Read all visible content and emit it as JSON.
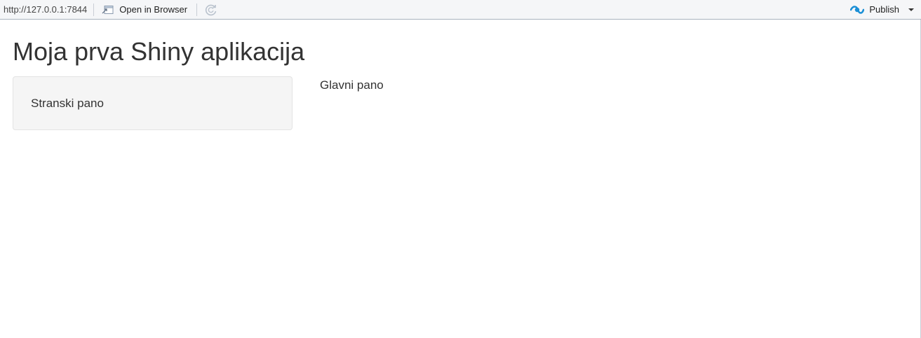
{
  "toolbar": {
    "url": "http://127.0.0.1:7844",
    "open_in_browser_label": "Open in Browser",
    "publish_label": "Publish",
    "publish_icon_color": "#1a8fd6"
  },
  "app": {
    "title": "Moja prva Shiny aplikacija",
    "sidebar_text": "Stranski pano",
    "main_text": "Glavni pano"
  }
}
